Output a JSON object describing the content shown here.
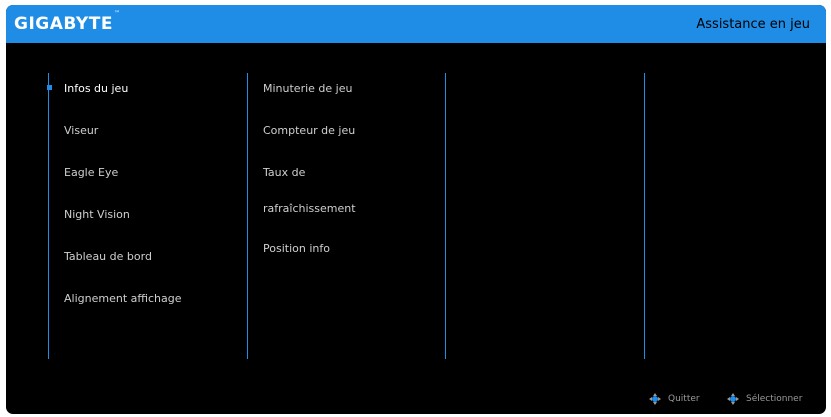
{
  "header": {
    "brand": "GIGABYTE",
    "brand_tm": "™",
    "title": "Assistance en jeu",
    "accent_color": "#1f8ce6"
  },
  "menu_primary": {
    "items": [
      {
        "label": "Infos du jeu",
        "selected": true
      },
      {
        "label": "Viseur"
      },
      {
        "label": "Eagle Eye"
      },
      {
        "label": "Night Vision"
      },
      {
        "label": "Tableau de bord"
      },
      {
        "label": "Alignement affichage"
      }
    ]
  },
  "menu_secondary": {
    "items": [
      {
        "label": "Minuterie de jeu"
      },
      {
        "label": "Compteur de jeu"
      },
      {
        "label": "Taux de"
      },
      {
        "label": "rafraîchissement"
      },
      {
        "label": "Position info"
      }
    ]
  },
  "footer": {
    "quit_label": "Quitter",
    "select_label": "Sélectionner",
    "quit_icon": "joystick-icon",
    "select_icon": "joystick-icon"
  }
}
